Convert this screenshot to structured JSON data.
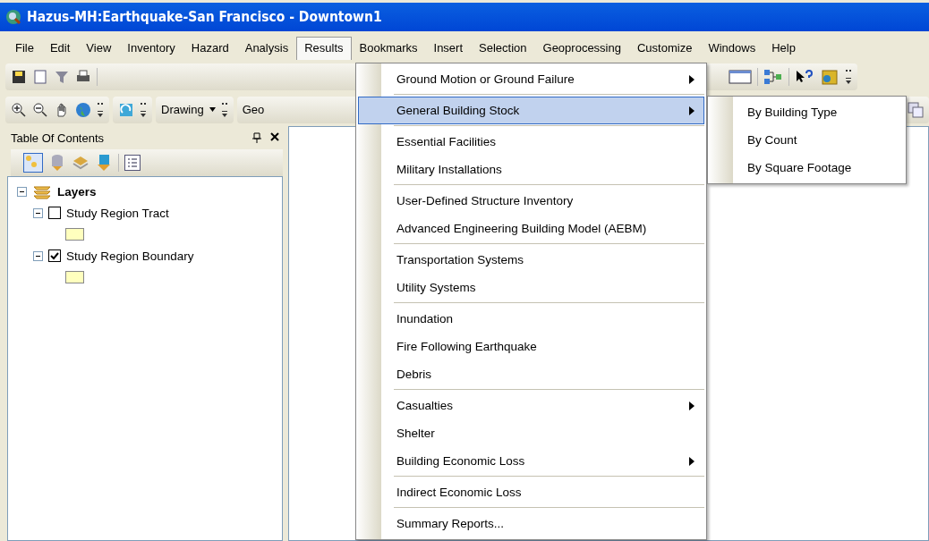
{
  "window": {
    "title": "Hazus-MH:Earthquake-San Francisco - Downtown1"
  },
  "menu_bar": [
    {
      "label": "File",
      "selected": false
    },
    {
      "label": "Edit",
      "selected": false
    },
    {
      "label": "View",
      "selected": false
    },
    {
      "label": "Inventory",
      "selected": false
    },
    {
      "label": "Hazard",
      "selected": false
    },
    {
      "label": "Analysis",
      "selected": false
    },
    {
      "label": "Results",
      "selected": true
    },
    {
      "label": "Bookmarks",
      "selected": false
    },
    {
      "label": "Insert",
      "selected": false
    },
    {
      "label": "Selection",
      "selected": false
    },
    {
      "label": "Geoprocessing",
      "selected": false
    },
    {
      "label": "Customize",
      "selected": false
    },
    {
      "label": "Windows",
      "selected": false
    },
    {
      "label": "Help",
      "selected": false
    }
  ],
  "toolbar_2": {
    "drawing_label": "Drawing",
    "cut_label": "Geo"
  },
  "table_of_contents": {
    "title": "Table Of Contents",
    "layers": {
      "label": "Layers",
      "expanded": true,
      "children": [
        {
          "label": "Study Region Tract",
          "checked": false,
          "expanded": true
        },
        {
          "label": "Study Region Boundary",
          "checked": true,
          "expanded": true
        }
      ]
    }
  },
  "results_menu": [
    [
      {
        "label": "Ground Motion or Ground Failure",
        "submenu": true,
        "selected": false
      }
    ],
    [
      {
        "label": "General Building Stock",
        "submenu": true,
        "selected": true
      }
    ],
    [
      {
        "label": "Essential Facilities",
        "submenu": false,
        "selected": false
      },
      {
        "label": "Military Installations",
        "submenu": false,
        "selected": false
      }
    ],
    [
      {
        "label": "User-Defined Structure Inventory",
        "submenu": false,
        "selected": false
      },
      {
        "label": "Advanced Engineering Building Model (AEBM)",
        "submenu": false,
        "selected": false
      }
    ],
    [
      {
        "label": "Transportation Systems",
        "submenu": false,
        "selected": false
      },
      {
        "label": "Utility Systems",
        "submenu": false,
        "selected": false
      }
    ],
    [
      {
        "label": "Inundation",
        "submenu": false,
        "selected": false
      },
      {
        "label": "Fire Following Earthquake",
        "submenu": false,
        "selected": false
      },
      {
        "label": "Debris",
        "submenu": false,
        "selected": false
      }
    ],
    [
      {
        "label": "Casualties",
        "submenu": true,
        "selected": false
      },
      {
        "label": "Shelter",
        "submenu": false,
        "selected": false
      },
      {
        "label": "Building Economic Loss",
        "submenu": true,
        "selected": false
      }
    ],
    [
      {
        "label": "Indirect Economic Loss",
        "submenu": false,
        "selected": false
      }
    ],
    [
      {
        "label": "Summary Reports...",
        "submenu": false,
        "selected": false
      }
    ]
  ],
  "submenu": [
    {
      "label": "By Building Type"
    },
    {
      "label": "By Count"
    },
    {
      "label": "By Square Footage"
    }
  ]
}
